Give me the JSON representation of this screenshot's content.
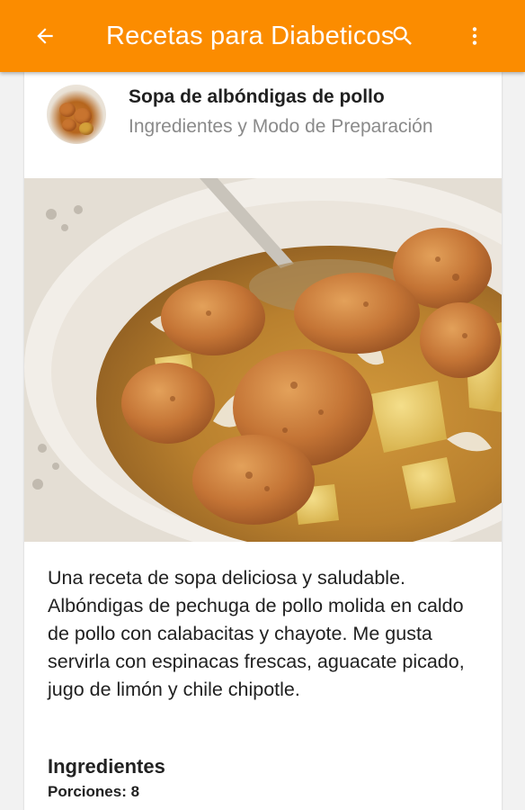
{
  "appbar": {
    "title": "Recetas para Diabeticos",
    "back_icon": "arrow-left-icon",
    "search_icon": "search-icon",
    "menu_icon": "more-vert-icon",
    "color": "#fb8c00"
  },
  "recipe": {
    "title": "Sopa de albóndigas de pollo",
    "subtitle": "Ingredientes y Modo de Preparación",
    "description": "Una receta de sopa deliciosa y saludable. Albóndigas de pechuga de pollo molida en caldo de pollo con calabacitas y chayote. Me gusta servirla con espinacas frescas, aguacate picado, jugo de limón y chile chipotle.",
    "ingredients_heading": "Ingredientes",
    "portions": "Porciones: 8"
  }
}
